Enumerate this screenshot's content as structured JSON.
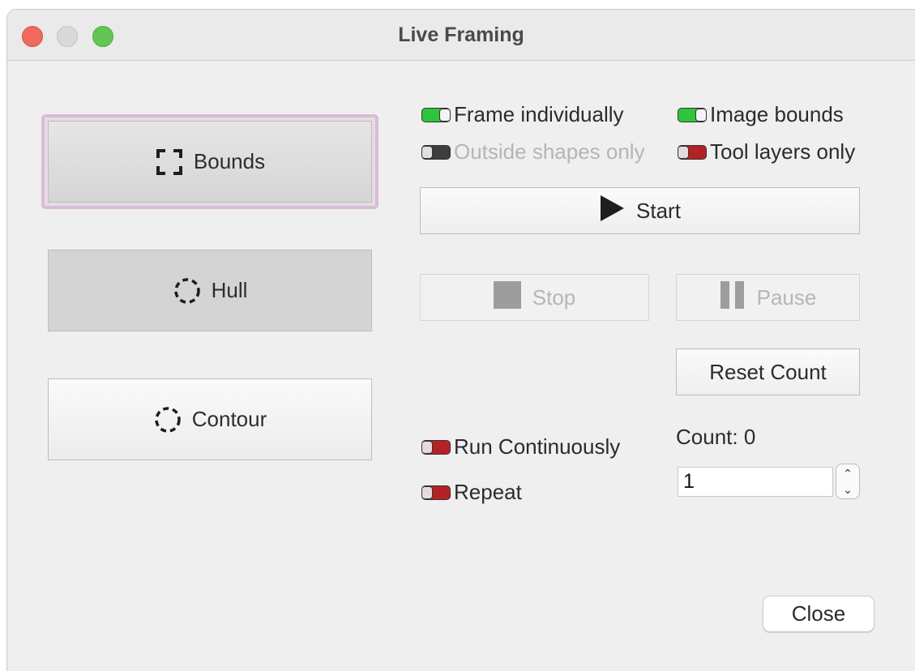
{
  "window": {
    "title": "Live Framing",
    "traffic_lights": [
      "close",
      "minimize",
      "zoom"
    ]
  },
  "mode_buttons": {
    "bounds": {
      "label": "Bounds",
      "icon": "bounds-corners-icon",
      "selected": true
    },
    "hull": {
      "label": "Hull",
      "icon": "dashed-circle-icon",
      "selected": false
    },
    "contour": {
      "label": "Contour",
      "icon": "dashed-circle-icon",
      "selected": false
    }
  },
  "options": {
    "frame_individually": {
      "label": "Frame individually",
      "state": "on"
    },
    "image_bounds": {
      "label": "Image bounds",
      "state": "on"
    },
    "outside_shapes_only": {
      "label": "Outside shapes only",
      "state": "off",
      "enabled": false
    },
    "tool_layers_only": {
      "label": "Tool layers only",
      "state": "off"
    },
    "run_continuously": {
      "label": "Run Continuously",
      "state": "off"
    },
    "repeat": {
      "label": "Repeat",
      "state": "off"
    }
  },
  "actions": {
    "start": {
      "label": "Start",
      "icon": "play-icon"
    },
    "stop": {
      "label": "Stop",
      "icon": "stop-icon",
      "enabled": false
    },
    "pause": {
      "label": "Pause",
      "icon": "pause-icon",
      "enabled": false
    },
    "reset_count": {
      "label": "Reset Count"
    },
    "close": {
      "label": "Close"
    }
  },
  "count": {
    "label": "Count: 0"
  },
  "repeat_value": "1",
  "colors": {
    "toggle_on": "#2fc43a",
    "toggle_off": "#b52226",
    "selected_outline": "#d8bcd6"
  }
}
